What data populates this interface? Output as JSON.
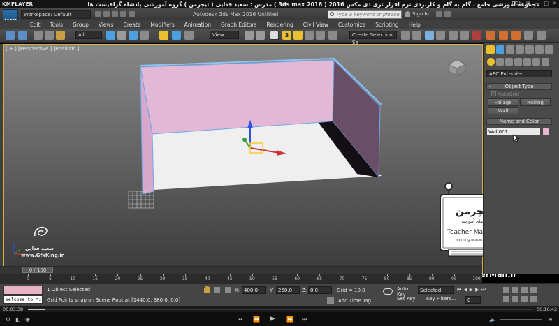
{
  "player": {
    "logo": "KMPLAYER",
    "title": "مجموعه آموزشی جامع ، گام به گام و کاربردی نرم افزار تری دی مکس 2016 ( 3ds max 2016 )  مدرس : سعید فدایی ( تیچرمن ) گروه آموزشی پادشاه گرافیست ها",
    "controls": [
      "BOX",
      "▣",
      "—",
      "□",
      "✕"
    ],
    "time_current": "00:03:38",
    "time_total": "00:16:42",
    "progress": 0.033
  },
  "max": {
    "logo": "MAX",
    "workspace": "Workspace: Default",
    "app_title": "Autodesk 3ds Max 2016    Untitled",
    "search_placeholder": "Type a keyword or phrase",
    "sign_in": "Sign In",
    "menus": [
      "Edit",
      "Tools",
      "Group",
      "Views",
      "Create",
      "Modifiers",
      "Animation",
      "Graph Editors",
      "Rendering",
      "Civil View",
      "Customize",
      "Scripting",
      "Help"
    ],
    "toolbar": {
      "filter": "All",
      "ref_coord": "View",
      "snap_label": "3",
      "selection_set": "Create Selection Se"
    },
    "viewport_label": "[ + ] [Perspective ] [Realistic ]",
    "command_panel": {
      "category": "AEC Extended",
      "object_type_title": "Object Type",
      "autogrid": "AutoGrid",
      "buttons": [
        "Foliage",
        "Railing",
        "Wall"
      ],
      "name_color_title": "Name and Color",
      "name_value": "Wall001",
      "color": "#e8b4d4"
    },
    "time_slider": "0 / 100",
    "ruler_ticks": [
      "0",
      "5",
      "10",
      "15",
      "20",
      "25",
      "30",
      "35",
      "40",
      "45",
      "50",
      "55",
      "60",
      "65",
      "70",
      "75",
      "80",
      "85",
      "90",
      "95",
      "100"
    ],
    "listener": "Welcome to M:",
    "selection_status": "1 Object Selected",
    "prompt": "Grid Points snap on Scene Root at [1440.0, 380.0, 0.0]",
    "coords": {
      "x_label": "X:",
      "x": "400.0",
      "y_label": "Y:",
      "y": "250.0",
      "z_label": "Z:",
      "z": "0.0"
    },
    "grid": "Grid = 10.0",
    "add_time_tag": "Add Time Tag",
    "auto_key": "Auto Key",
    "set_key": "Set Key",
    "selected": "Selected",
    "key_filters": "Key Filters...",
    "frame": "0"
  },
  "watermark": {
    "name": "سعید فدایی",
    "site": "www.GfxKing.ir",
    "tm_title": "تیچرمن",
    "tm_sub": "راهنمای آموزشی",
    "tm_en": "Teacher Man",
    "tm_small": "learning academy",
    "tm_url": "www.TeacherMan.ir"
  }
}
